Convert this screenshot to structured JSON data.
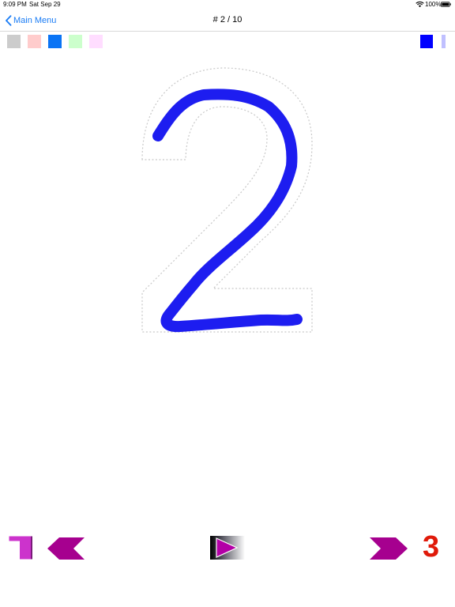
{
  "status_bar": {
    "time": "9:09 PM",
    "date": "Sat Sep 29",
    "battery": "100%"
  },
  "nav": {
    "back_label": "Main Menu",
    "title": "# 2 / 10"
  },
  "palette": {
    "colors": [
      "#cccccc",
      "#ffcccc",
      "#0a74f5",
      "#ccffcc",
      "#ffddff"
    ]
  },
  "brush": {
    "color": "#0000ff",
    "light_color": "#c0c0ff"
  },
  "trace": {
    "digit": "2",
    "stroke_color": "#1d1df0"
  },
  "controls": {
    "next_digit": "3",
    "next_digit_color": "#e01a0a",
    "arrow_color": "#a6008f",
    "restart_color": "#cc33cc"
  }
}
